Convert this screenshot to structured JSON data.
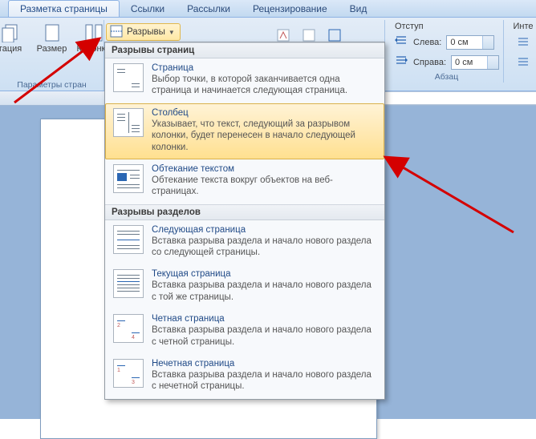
{
  "tabs": {
    "tab0": "Разметка страницы",
    "tab1": "Ссылки",
    "tab2": "Рассылки",
    "tab3": "Рецензирование",
    "tab4": "Вид"
  },
  "ribbon": {
    "orientation": "тация",
    "size": "Размер",
    "columns": "Колонки",
    "page_params_group": "Параметры стран",
    "breaks_btn": "Разрывы",
    "indent_header": "Отступ",
    "left_label": "Слева:",
    "right_label": "Справа:",
    "left_value": "0 см",
    "right_value": "0 см",
    "paragraph_group": "Абзац",
    "inter": "Инте"
  },
  "gallery": {
    "sec1": "Разрывы страниц",
    "sec2": "Разрывы разделов",
    "items": {
      "page": {
        "title": "Страница",
        "desc": "Выбор точки, в которой заканчивается одна страница и начинается следующая страница."
      },
      "column": {
        "title": "Столбец",
        "desc": "Указывает, что текст, следующий за разрывом колонки, будет перенесен в начало следующей колонки."
      },
      "wrap": {
        "title": "Обтекание текстом",
        "desc": "Обтекание текста вокруг объектов на веб-страницах."
      },
      "nextpage": {
        "title": "Следующая страница",
        "desc": "Вставка разрыва раздела и начало нового раздела со следующей страницы."
      },
      "cont": {
        "title": "Текущая страница",
        "desc": "Вставка разрыва раздела и начало нового раздела с той же страницы."
      },
      "even": {
        "title": "Четная страница",
        "desc": "Вставка разрыва раздела и начало нового раздела с четной страницы."
      },
      "odd": {
        "title": "Нечетная страница",
        "desc": "Вставка разрыва раздела и начало нового раздела с нечетной страницы."
      }
    }
  }
}
